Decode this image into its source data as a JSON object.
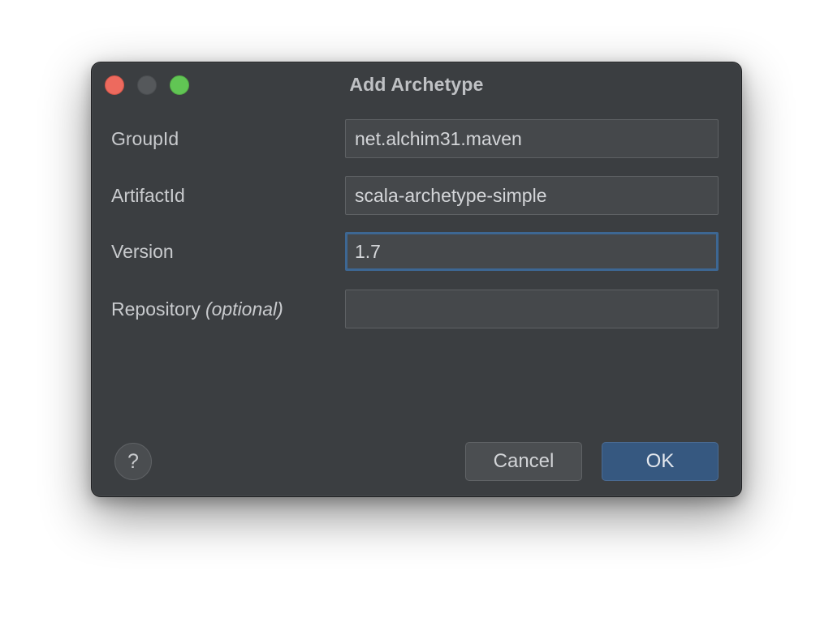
{
  "dialog": {
    "title": "Add Archetype"
  },
  "fields": {
    "group_id": {
      "label": "GroupId",
      "value": "net.alchim31.maven"
    },
    "artifact_id": {
      "label": "ArtifactId",
      "value": "scala-archetype-simple"
    },
    "version": {
      "label": "Version",
      "value": "1.7"
    },
    "repository": {
      "label": "Repository",
      "label_suffix": "(optional)",
      "value": ""
    }
  },
  "buttons": {
    "help_label": "?",
    "cancel_label": "Cancel",
    "ok_label": "OK"
  },
  "colors": {
    "window_bg": "#3b3e41",
    "field_bg": "#45484b",
    "focus_border": "#3d6793",
    "ok_button_bg": "#365880",
    "traffic_close": "#ed6a5e",
    "traffic_zoom": "#61c554"
  }
}
